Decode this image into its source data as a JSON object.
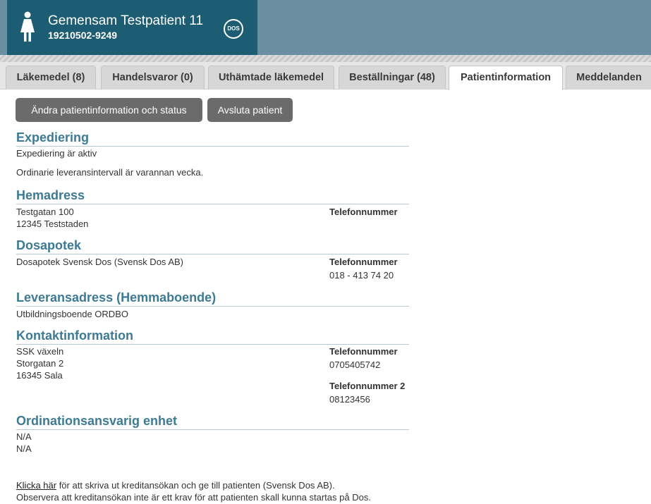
{
  "patient": {
    "name": "Gemensam Testpatient 11",
    "personnummer": "19210502-9249",
    "badge": "DOS",
    "icon": "female-person-icon"
  },
  "tabs": [
    {
      "label": "Läkemedel  (8)",
      "active": false
    },
    {
      "label": "Handelsvaror (0)",
      "active": false
    },
    {
      "label": "Uthämtade läkemedel",
      "active": false
    },
    {
      "label": "Beställningar (48)",
      "active": false
    },
    {
      "label": "Patientinformation",
      "active": true
    },
    {
      "label": "Meddelanden",
      "active": false
    }
  ],
  "actions": {
    "edit_label": "Ändra patientinformation och status",
    "end_label": "Avsluta patient"
  },
  "expediering": {
    "title": "Expediering",
    "status": "Expediering är aktiv",
    "interval": "Ordinarie leveransintervall är varannan vecka."
  },
  "hemadress": {
    "title": "Hemadress",
    "street": "Testgatan 100",
    "city": "12345 Teststaden",
    "phone_label": "Telefonnummer"
  },
  "dosapotek": {
    "title": "Dosapotek",
    "name": "Dosapotek Svensk Dos (Svensk Dos AB)",
    "phone_label": "Telefonnummer",
    "phone": "018 - 413 74 20"
  },
  "leveransadress": {
    "title": "Leveransadress (Hemmaboende)",
    "name": "Utbildningsboende ORDBO"
  },
  "kontakt": {
    "title": "Kontaktinformation",
    "name": "SSK växeln",
    "street": "Storgatan 2",
    "city": "16345 Sala",
    "phone_label": "Telefonnummer",
    "phone": "0705405742",
    "phone2_label": "Telefonnummer 2",
    "phone2": "08123456"
  },
  "ordination": {
    "title": "Ordinationsansvarig enhet",
    "line1": "N/A",
    "line2": "N/A"
  },
  "footer": {
    "link_text": "Klicka här",
    "link_rest": " för att skriva ut kreditansökan och ge till patienten (Svensk Dos AB).",
    "note": "Observera att kreditansökan inte är ett krav för att patienten skall kunna startas på Dos."
  },
  "colors": {
    "header_bg": "#6a8fa0",
    "patient_card": "#1d5d74",
    "section_title": "#3c7a96",
    "button_bg": "#6b6b6b"
  }
}
